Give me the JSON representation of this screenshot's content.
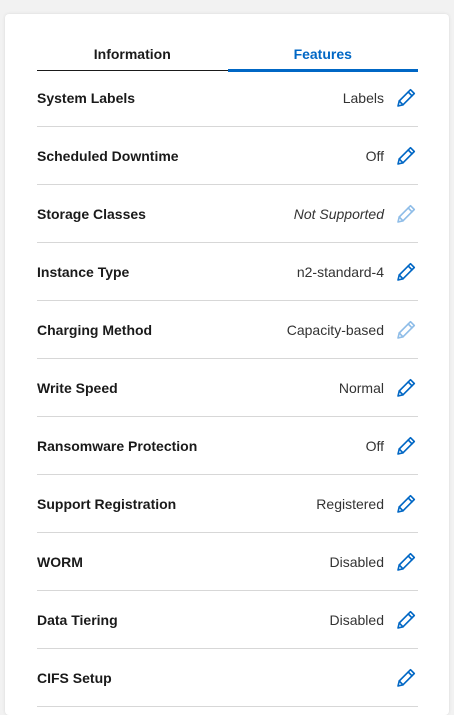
{
  "tabs": [
    {
      "label": "Information",
      "active": false
    },
    {
      "label": "Features",
      "active": true
    }
  ],
  "colors": {
    "accent": "#0067c5",
    "disabled_icon": "#8fbde8",
    "divider": "#d7d7d7"
  },
  "rows": [
    {
      "label": "System Labels",
      "value": "Labels",
      "italic": false,
      "edit_enabled": true,
      "icon": "pencil-icon"
    },
    {
      "label": "Scheduled Downtime",
      "value": "Off",
      "italic": false,
      "edit_enabled": true,
      "icon": "pencil-icon"
    },
    {
      "label": "Storage Classes",
      "value": "Not Supported",
      "italic": true,
      "edit_enabled": false,
      "icon": "pencil-icon"
    },
    {
      "label": "Instance Type",
      "value": "n2-standard-4",
      "italic": false,
      "edit_enabled": true,
      "icon": "pencil-icon"
    },
    {
      "label": "Charging Method",
      "value": "Capacity-based",
      "italic": false,
      "edit_enabled": false,
      "icon": "pencil-icon"
    },
    {
      "label": "Write Speed",
      "value": "Normal",
      "italic": false,
      "edit_enabled": true,
      "icon": "pencil-icon"
    },
    {
      "label": "Ransomware Protection",
      "value": "Off",
      "italic": false,
      "edit_enabled": true,
      "icon": "pencil-icon"
    },
    {
      "label": "Support Registration",
      "value": "Registered",
      "italic": false,
      "edit_enabled": true,
      "icon": "pencil-icon"
    },
    {
      "label": "WORM",
      "value": "Disabled",
      "italic": false,
      "edit_enabled": true,
      "icon": "pencil-icon"
    },
    {
      "label": "Data Tiering",
      "value": "Disabled",
      "italic": false,
      "edit_enabled": true,
      "icon": "pencil-icon"
    },
    {
      "label": "CIFS Setup",
      "value": "",
      "italic": false,
      "edit_enabled": true,
      "icon": "pencil-icon"
    }
  ]
}
